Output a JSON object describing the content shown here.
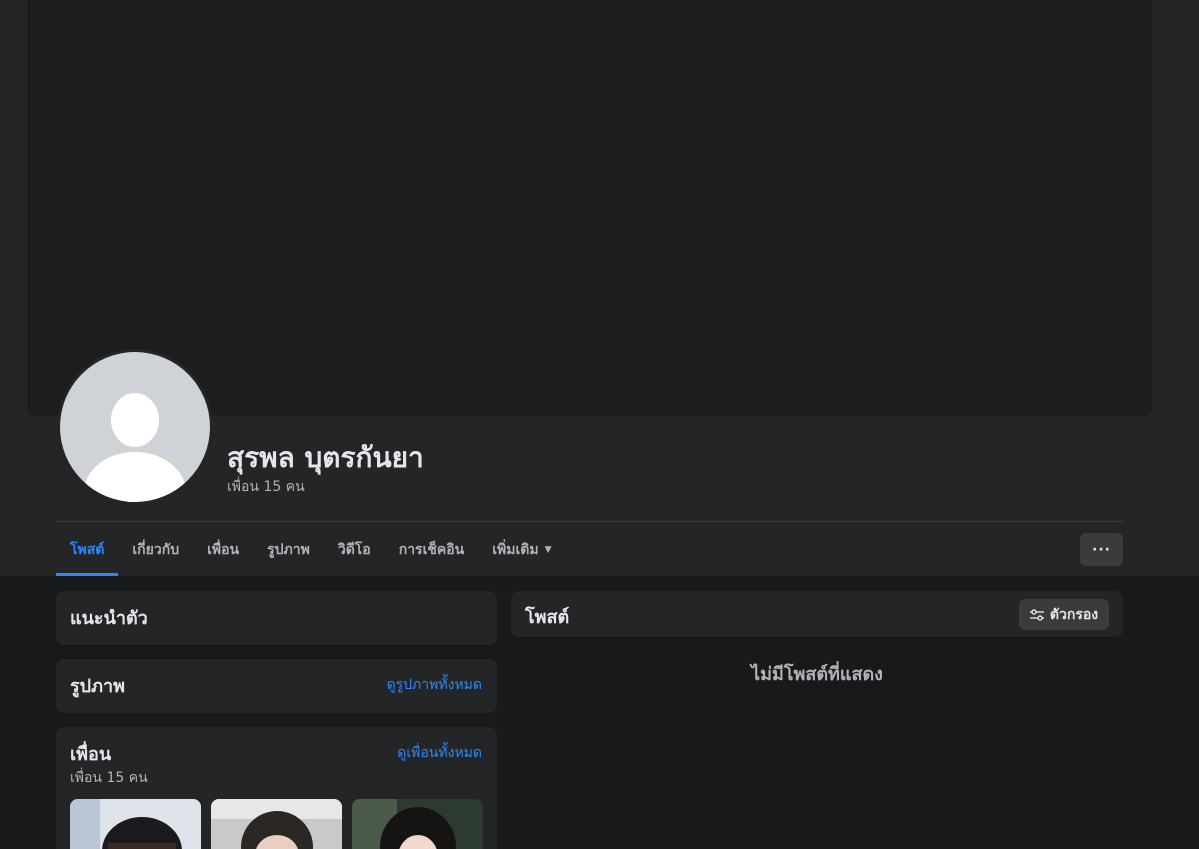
{
  "profile": {
    "name": "สุรพล บุตรกันยา",
    "friend_count": "เพื่อน 15 คน"
  },
  "tabs": [
    {
      "label": "โพสต์"
    },
    {
      "label": "เกี่ยวกับ"
    },
    {
      "label": "เพื่อน"
    },
    {
      "label": "รูปภาพ"
    },
    {
      "label": "วิดีโอ"
    },
    {
      "label": "การเช็คอิน"
    },
    {
      "label": "เพิ่มเติม"
    }
  ],
  "more_button": {
    "label": "···"
  },
  "intro": {
    "title": "แนะนำตัว"
  },
  "photos": {
    "title": "รูปภาพ",
    "link": "ดูรูปภาพทั้งหมด"
  },
  "friends": {
    "title": "เพื่อน",
    "link": "ดูเพื่อนทั้งหมด",
    "count": "เพื่อน 15 คน"
  },
  "posts": {
    "title": "โพสต์",
    "filter_label": "ตัวกรอง",
    "empty_text": "ไม่มีโพสต์ที่แสดง"
  },
  "colors": {
    "background": "#18191a",
    "surface": "#242526",
    "accent": "#2d88ff"
  },
  "icons": [
    "avatar-placeholder",
    "caret-down-icon",
    "filter-icon"
  ]
}
